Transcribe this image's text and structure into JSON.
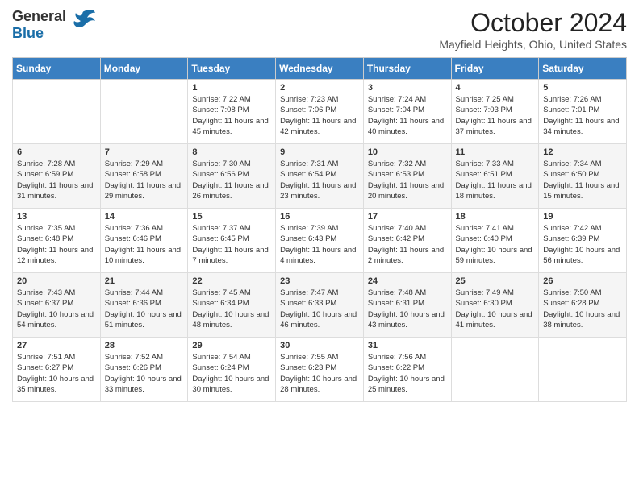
{
  "header": {
    "logo_general": "General",
    "logo_blue": "Blue",
    "month": "October 2024",
    "location": "Mayfield Heights, Ohio, United States"
  },
  "days_of_week": [
    "Sunday",
    "Monday",
    "Tuesday",
    "Wednesday",
    "Thursday",
    "Friday",
    "Saturday"
  ],
  "weeks": [
    [
      {
        "day": "",
        "sunrise": "",
        "sunset": "",
        "daylight": ""
      },
      {
        "day": "",
        "sunrise": "",
        "sunset": "",
        "daylight": ""
      },
      {
        "day": "1",
        "sunrise": "Sunrise: 7:22 AM",
        "sunset": "Sunset: 7:08 PM",
        "daylight": "Daylight: 11 hours and 45 minutes."
      },
      {
        "day": "2",
        "sunrise": "Sunrise: 7:23 AM",
        "sunset": "Sunset: 7:06 PM",
        "daylight": "Daylight: 11 hours and 42 minutes."
      },
      {
        "day": "3",
        "sunrise": "Sunrise: 7:24 AM",
        "sunset": "Sunset: 7:04 PM",
        "daylight": "Daylight: 11 hours and 40 minutes."
      },
      {
        "day": "4",
        "sunrise": "Sunrise: 7:25 AM",
        "sunset": "Sunset: 7:03 PM",
        "daylight": "Daylight: 11 hours and 37 minutes."
      },
      {
        "day": "5",
        "sunrise": "Sunrise: 7:26 AM",
        "sunset": "Sunset: 7:01 PM",
        "daylight": "Daylight: 11 hours and 34 minutes."
      }
    ],
    [
      {
        "day": "6",
        "sunrise": "Sunrise: 7:28 AM",
        "sunset": "Sunset: 6:59 PM",
        "daylight": "Daylight: 11 hours and 31 minutes."
      },
      {
        "day": "7",
        "sunrise": "Sunrise: 7:29 AM",
        "sunset": "Sunset: 6:58 PM",
        "daylight": "Daylight: 11 hours and 29 minutes."
      },
      {
        "day": "8",
        "sunrise": "Sunrise: 7:30 AM",
        "sunset": "Sunset: 6:56 PM",
        "daylight": "Daylight: 11 hours and 26 minutes."
      },
      {
        "day": "9",
        "sunrise": "Sunrise: 7:31 AM",
        "sunset": "Sunset: 6:54 PM",
        "daylight": "Daylight: 11 hours and 23 minutes."
      },
      {
        "day": "10",
        "sunrise": "Sunrise: 7:32 AM",
        "sunset": "Sunset: 6:53 PM",
        "daylight": "Daylight: 11 hours and 20 minutes."
      },
      {
        "day": "11",
        "sunrise": "Sunrise: 7:33 AM",
        "sunset": "Sunset: 6:51 PM",
        "daylight": "Daylight: 11 hours and 18 minutes."
      },
      {
        "day": "12",
        "sunrise": "Sunrise: 7:34 AM",
        "sunset": "Sunset: 6:50 PM",
        "daylight": "Daylight: 11 hours and 15 minutes."
      }
    ],
    [
      {
        "day": "13",
        "sunrise": "Sunrise: 7:35 AM",
        "sunset": "Sunset: 6:48 PM",
        "daylight": "Daylight: 11 hours and 12 minutes."
      },
      {
        "day": "14",
        "sunrise": "Sunrise: 7:36 AM",
        "sunset": "Sunset: 6:46 PM",
        "daylight": "Daylight: 11 hours and 10 minutes."
      },
      {
        "day": "15",
        "sunrise": "Sunrise: 7:37 AM",
        "sunset": "Sunset: 6:45 PM",
        "daylight": "Daylight: 11 hours and 7 minutes."
      },
      {
        "day": "16",
        "sunrise": "Sunrise: 7:39 AM",
        "sunset": "Sunset: 6:43 PM",
        "daylight": "Daylight: 11 hours and 4 minutes."
      },
      {
        "day": "17",
        "sunrise": "Sunrise: 7:40 AM",
        "sunset": "Sunset: 6:42 PM",
        "daylight": "Daylight: 11 hours and 2 minutes."
      },
      {
        "day": "18",
        "sunrise": "Sunrise: 7:41 AM",
        "sunset": "Sunset: 6:40 PM",
        "daylight": "Daylight: 10 hours and 59 minutes."
      },
      {
        "day": "19",
        "sunrise": "Sunrise: 7:42 AM",
        "sunset": "Sunset: 6:39 PM",
        "daylight": "Daylight: 10 hours and 56 minutes."
      }
    ],
    [
      {
        "day": "20",
        "sunrise": "Sunrise: 7:43 AM",
        "sunset": "Sunset: 6:37 PM",
        "daylight": "Daylight: 10 hours and 54 minutes."
      },
      {
        "day": "21",
        "sunrise": "Sunrise: 7:44 AM",
        "sunset": "Sunset: 6:36 PM",
        "daylight": "Daylight: 10 hours and 51 minutes."
      },
      {
        "day": "22",
        "sunrise": "Sunrise: 7:45 AM",
        "sunset": "Sunset: 6:34 PM",
        "daylight": "Daylight: 10 hours and 48 minutes."
      },
      {
        "day": "23",
        "sunrise": "Sunrise: 7:47 AM",
        "sunset": "Sunset: 6:33 PM",
        "daylight": "Daylight: 10 hours and 46 minutes."
      },
      {
        "day": "24",
        "sunrise": "Sunrise: 7:48 AM",
        "sunset": "Sunset: 6:31 PM",
        "daylight": "Daylight: 10 hours and 43 minutes."
      },
      {
        "day": "25",
        "sunrise": "Sunrise: 7:49 AM",
        "sunset": "Sunset: 6:30 PM",
        "daylight": "Daylight: 10 hours and 41 minutes."
      },
      {
        "day": "26",
        "sunrise": "Sunrise: 7:50 AM",
        "sunset": "Sunset: 6:28 PM",
        "daylight": "Daylight: 10 hours and 38 minutes."
      }
    ],
    [
      {
        "day": "27",
        "sunrise": "Sunrise: 7:51 AM",
        "sunset": "Sunset: 6:27 PM",
        "daylight": "Daylight: 10 hours and 35 minutes."
      },
      {
        "day": "28",
        "sunrise": "Sunrise: 7:52 AM",
        "sunset": "Sunset: 6:26 PM",
        "daylight": "Daylight: 10 hours and 33 minutes."
      },
      {
        "day": "29",
        "sunrise": "Sunrise: 7:54 AM",
        "sunset": "Sunset: 6:24 PM",
        "daylight": "Daylight: 10 hours and 30 minutes."
      },
      {
        "day": "30",
        "sunrise": "Sunrise: 7:55 AM",
        "sunset": "Sunset: 6:23 PM",
        "daylight": "Daylight: 10 hours and 28 minutes."
      },
      {
        "day": "31",
        "sunrise": "Sunrise: 7:56 AM",
        "sunset": "Sunset: 6:22 PM",
        "daylight": "Daylight: 10 hours and 25 minutes."
      },
      {
        "day": "",
        "sunrise": "",
        "sunset": "",
        "daylight": ""
      },
      {
        "day": "",
        "sunrise": "",
        "sunset": "",
        "daylight": ""
      }
    ]
  ]
}
